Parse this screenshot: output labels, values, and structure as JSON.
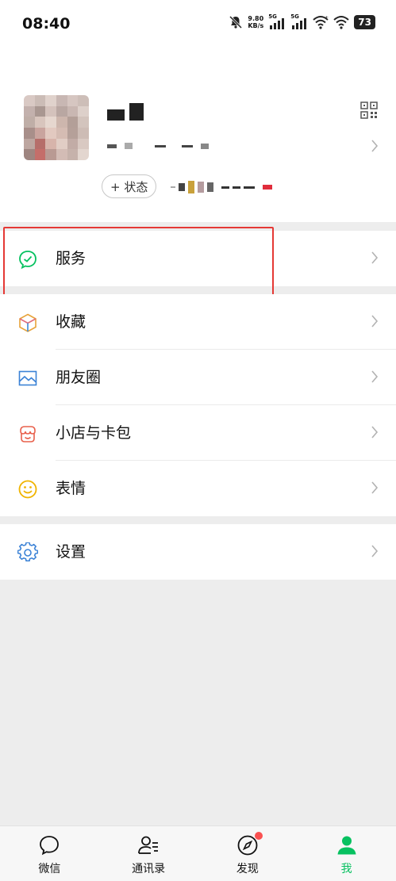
{
  "status_bar": {
    "time": "08:40",
    "net_speed_value": "9.80",
    "net_speed_unit": "KB/s",
    "signal_1_label": "5G",
    "signal_2_label": "5G",
    "battery": "73"
  },
  "profile": {
    "status_button": "+ 状态"
  },
  "menu": {
    "services": "服务",
    "favorites": "收藏",
    "moments": "朋友圈",
    "shop_cards": "小店与卡包",
    "stickers": "表情",
    "settings": "设置"
  },
  "tabbar": {
    "chats": "微信",
    "contacts": "通讯录",
    "discover": "发现",
    "me": "我"
  },
  "colors": {
    "accent_green": "#07c160",
    "highlight_red": "#e53935",
    "badge_red": "#fa5151"
  }
}
